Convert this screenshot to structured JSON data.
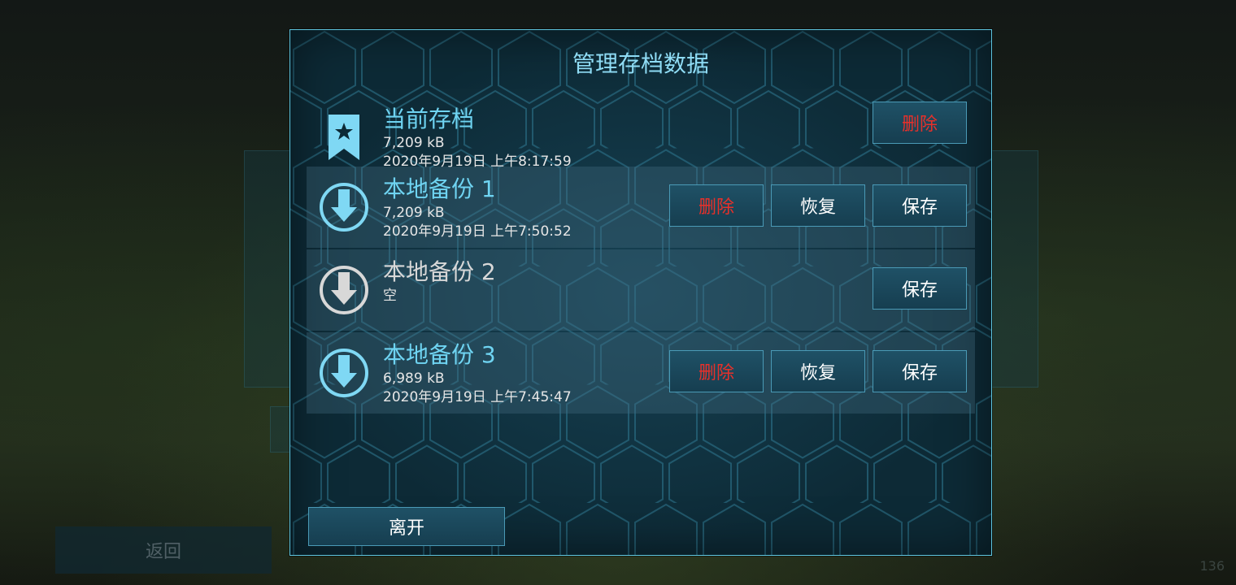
{
  "dialog": {
    "title": "管理存档数据",
    "current": {
      "name": "当前存档",
      "size": "7,209 kB",
      "date": "2020年9月19日 上午8:17:59",
      "delete_label": "删除"
    },
    "backups": [
      {
        "name": "本地备份 1",
        "size": "7,209 kB",
        "date": "2020年9月19日 上午7:50:52",
        "delete_label": "删除",
        "restore_label": "恢复",
        "save_label": "保存"
      },
      {
        "name": "本地备份 2",
        "status": "空",
        "save_label": "保存"
      },
      {
        "name": "本地备份 3",
        "size": "6,989 kB",
        "date": "2020年9月19日 上午7:45:47",
        "delete_label": "删除",
        "restore_label": "恢复",
        "save_label": "保存"
      }
    ],
    "leave_label": "离开"
  },
  "background": {
    "back_label": "返回",
    "corner_number": "136"
  },
  "icons": {
    "current": "bookmark-star-icon",
    "backup_filled": "download-arrow-icon",
    "backup_empty": "download-arrow-icon"
  },
  "colors": {
    "accent": "#6fd4f2",
    "danger": "#e8302a",
    "empty": "#d8d8d8",
    "border": "#5fc6e0"
  }
}
